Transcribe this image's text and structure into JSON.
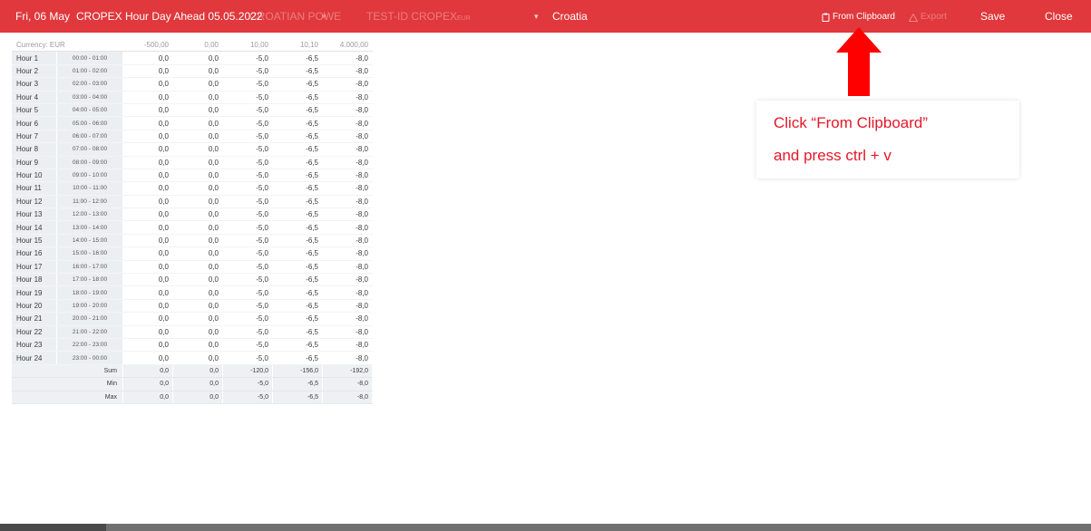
{
  "toolbar": {
    "date": "Fri, 06 May",
    "title": "CROPEX Hour Day Ahead 05.05.2022",
    "company": "CROATIAN POWE",
    "company_arrow": "▾",
    "portfolio": "TEST-ID CROPEX",
    "portfolio_suffix": "EUR",
    "region_arrow": "▾",
    "region": "Croatia",
    "from_clipboard": "From Clipboard",
    "export": "Export",
    "save": "Save",
    "close": "Close"
  },
  "table": {
    "currency_label": "Currency: EUR",
    "price_headers": [
      "-500,00",
      "0,00",
      "10,00",
      "10,10",
      "4.000,00"
    ],
    "rows": [
      {
        "hour": "Hour 1",
        "range": "00:00 - 01:00",
        "values": [
          "0,0",
          "0,0",
          "-5,0",
          "-6,5",
          "-8,0"
        ]
      },
      {
        "hour": "Hour 2",
        "range": "01:00 - 02:00",
        "values": [
          "0,0",
          "0,0",
          "-5,0",
          "-6,5",
          "-8,0"
        ]
      },
      {
        "hour": "Hour 3",
        "range": "02:00 - 03:00",
        "values": [
          "0,0",
          "0,0",
          "-5,0",
          "-6,5",
          "-8,0"
        ]
      },
      {
        "hour": "Hour 4",
        "range": "03:00 - 04:00",
        "values": [
          "0,0",
          "0,0",
          "-5,0",
          "-6,5",
          "-8,0"
        ]
      },
      {
        "hour": "Hour 5",
        "range": "04:00 - 05:00",
        "values": [
          "0,0",
          "0,0",
          "-5,0",
          "-6,5",
          "-8,0"
        ]
      },
      {
        "hour": "Hour 6",
        "range": "05:00 - 06:00",
        "values": [
          "0,0",
          "0,0",
          "-5,0",
          "-6,5",
          "-8,0"
        ]
      },
      {
        "hour": "Hour 7",
        "range": "06:00 - 07:00",
        "values": [
          "0,0",
          "0,0",
          "-5,0",
          "-6,5",
          "-8,0"
        ]
      },
      {
        "hour": "Hour 8",
        "range": "07:00 - 08:00",
        "values": [
          "0,0",
          "0,0",
          "-5,0",
          "-6,5",
          "-8,0"
        ]
      },
      {
        "hour": "Hour 9",
        "range": "08:00 - 09:00",
        "values": [
          "0,0",
          "0,0",
          "-5,0",
          "-6,5",
          "-8,0"
        ]
      },
      {
        "hour": "Hour 10",
        "range": "09:00 - 10:00",
        "values": [
          "0,0",
          "0,0",
          "-5,0",
          "-6,5",
          "-8,0"
        ]
      },
      {
        "hour": "Hour 11",
        "range": "10:00 - 11:00",
        "values": [
          "0,0",
          "0,0",
          "-5,0",
          "-6,5",
          "-8,0"
        ]
      },
      {
        "hour": "Hour 12",
        "range": "11:00 - 12:00",
        "values": [
          "0,0",
          "0,0",
          "-5,0",
          "-6,5",
          "-8,0"
        ]
      },
      {
        "hour": "Hour 13",
        "range": "12:00 - 13:00",
        "values": [
          "0,0",
          "0,0",
          "-5,0",
          "-6,5",
          "-8,0"
        ]
      },
      {
        "hour": "Hour 14",
        "range": "13:00 - 14:00",
        "values": [
          "0,0",
          "0,0",
          "-5,0",
          "-6,5",
          "-8,0"
        ]
      },
      {
        "hour": "Hour 15",
        "range": "14:00 - 15:00",
        "values": [
          "0,0",
          "0,0",
          "-5,0",
          "-6,5",
          "-8,0"
        ]
      },
      {
        "hour": "Hour 16",
        "range": "15:00 - 16:00",
        "values": [
          "0,0",
          "0,0",
          "-5,0",
          "-6,5",
          "-8,0"
        ]
      },
      {
        "hour": "Hour 17",
        "range": "16:00 - 17:00",
        "values": [
          "0,0",
          "0,0",
          "-5,0",
          "-6,5",
          "-8,0"
        ]
      },
      {
        "hour": "Hour 18",
        "range": "17:00 - 18:00",
        "values": [
          "0,0",
          "0,0",
          "-5,0",
          "-6,5",
          "-8,0"
        ]
      },
      {
        "hour": "Hour 19",
        "range": "18:00 - 19:00",
        "values": [
          "0,0",
          "0,0",
          "-5,0",
          "-6,5",
          "-8,0"
        ]
      },
      {
        "hour": "Hour 20",
        "range": "19:00 - 20:00",
        "values": [
          "0,0",
          "0,0",
          "-5,0",
          "-6,5",
          "-8,0"
        ]
      },
      {
        "hour": "Hour 21",
        "range": "20:00 - 21:00",
        "values": [
          "0,0",
          "0,0",
          "-5,0",
          "-6,5",
          "-8,0"
        ]
      },
      {
        "hour": "Hour 22",
        "range": "21:00 - 22:00",
        "values": [
          "0,0",
          "0,0",
          "-5,0",
          "-6,5",
          "-8,0"
        ]
      },
      {
        "hour": "Hour 23",
        "range": "22:00 - 23:00",
        "values": [
          "0,0",
          "0,0",
          "-5,0",
          "-6,5",
          "-8,0"
        ]
      },
      {
        "hour": "Hour 24",
        "range": "23:00 - 00:00",
        "values": [
          "0,0",
          "0,0",
          "-5,0",
          "-6,5",
          "-8,0"
        ]
      }
    ],
    "summary": [
      {
        "label": "Sum",
        "values": [
          "0,0",
          "0,0",
          "-120,0",
          "-156,0",
          "-192,0"
        ]
      },
      {
        "label": "Min",
        "values": [
          "0,0",
          "0,0",
          "-5,0",
          "-6,5",
          "-8,0"
        ]
      },
      {
        "label": "Max",
        "values": [
          "0,0",
          "0,0",
          "-5,0",
          "-6,5",
          "-8,0"
        ]
      }
    ]
  },
  "annotation": {
    "line1": "Click “From Clipboard”",
    "line2": "and press ctrl + v",
    "color": "#e4172a"
  },
  "icons": {
    "clipboard": "clipboard-icon",
    "export": "warning-icon"
  },
  "colors": {
    "toolbar_bg": "#e0383c",
    "arrow": "#ff0000"
  }
}
